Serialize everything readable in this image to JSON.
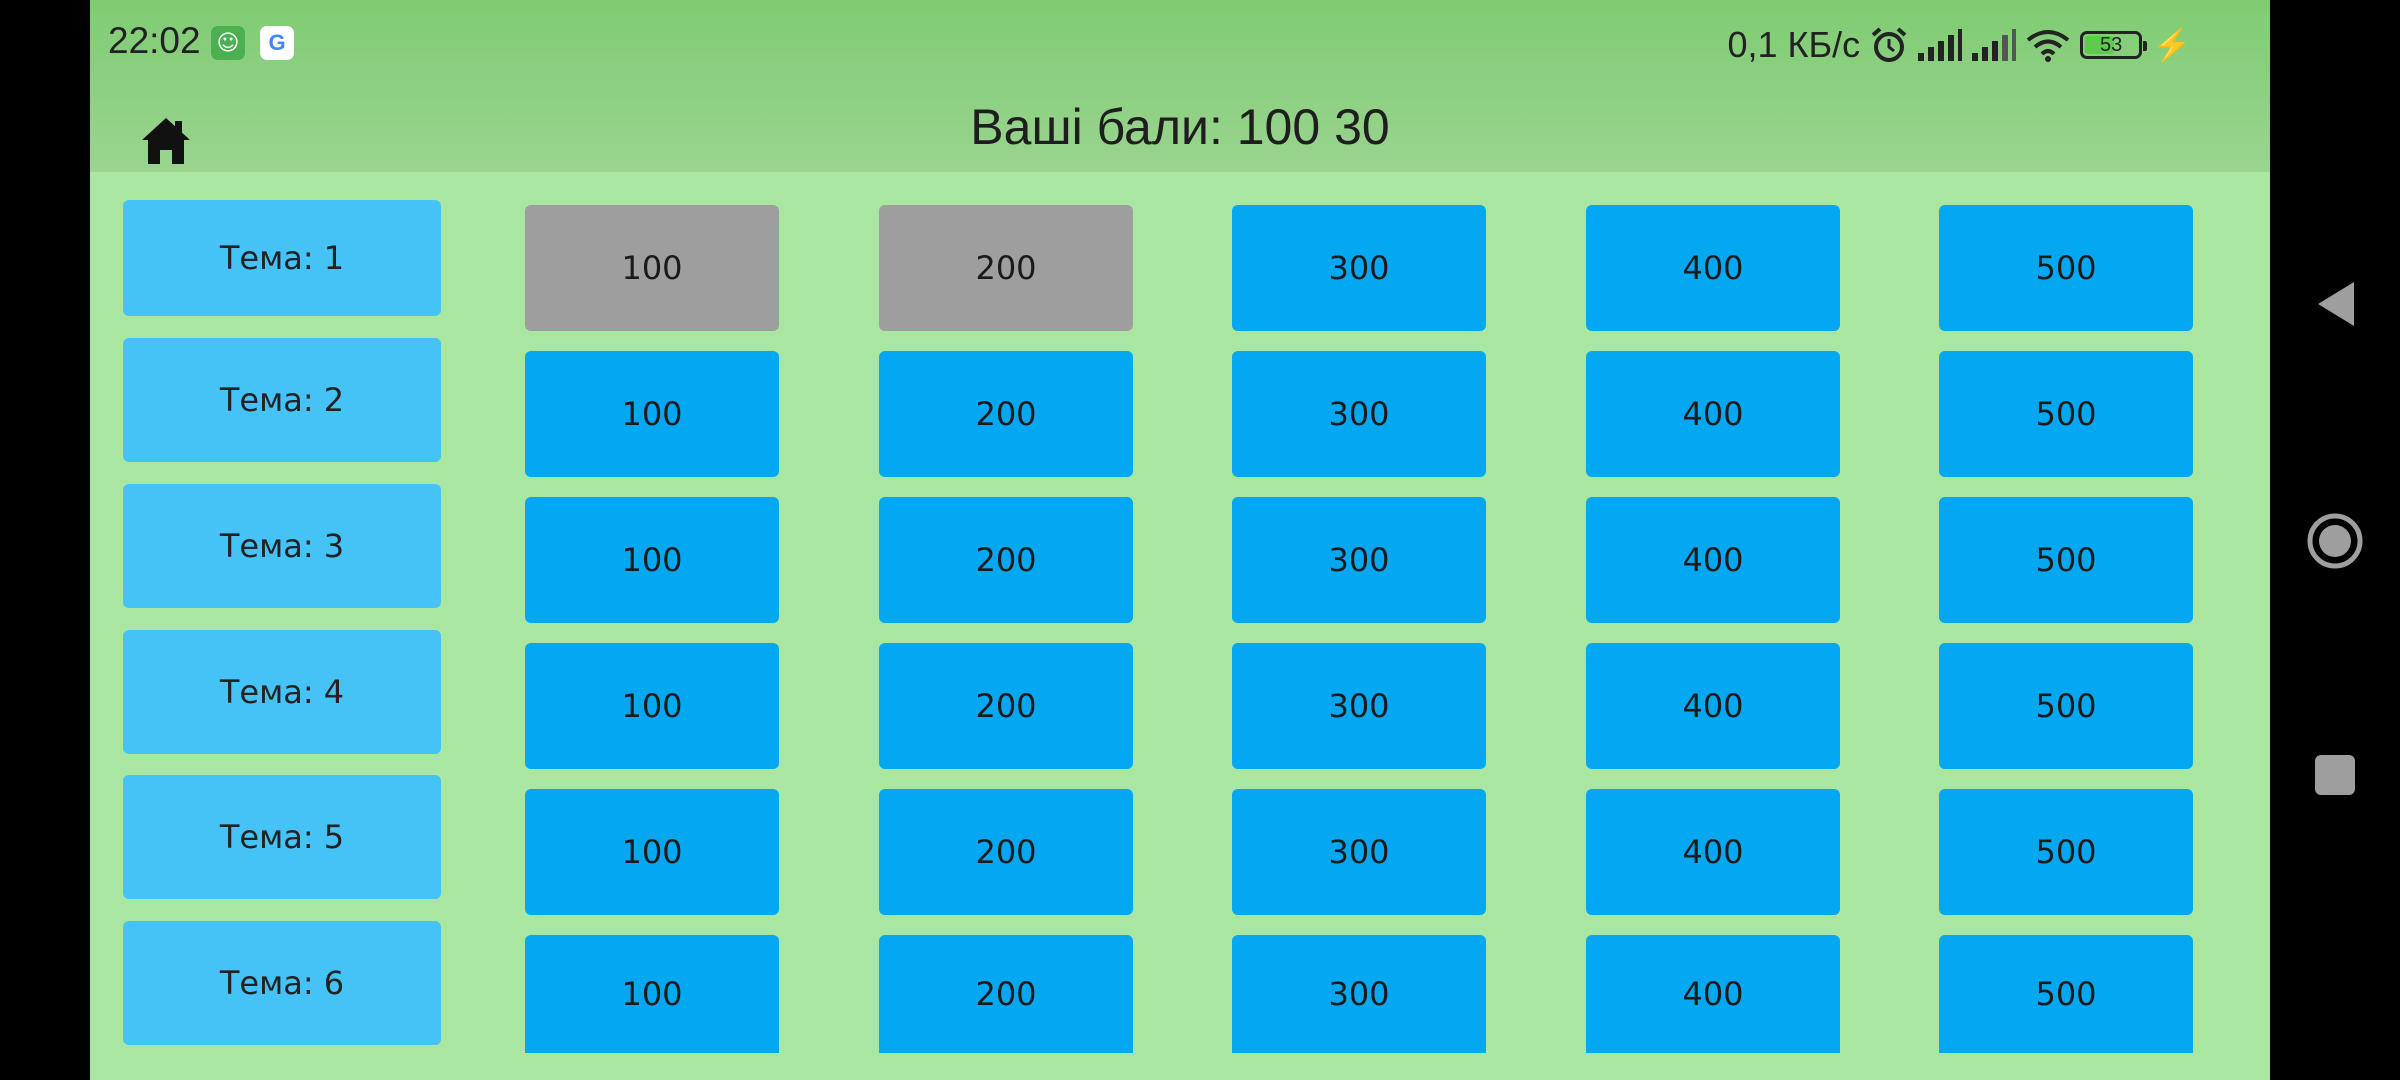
{
  "status_bar": {
    "time": "22:02",
    "speed": "0,1 КБ/с",
    "battery": "53",
    "battery_level": 0.53,
    "icons": [
      "app-notification-icon",
      "google-icon",
      "alarm-icon",
      "signal-icon",
      "signal-icon-2",
      "wifi-icon",
      "battery-icon",
      "charging-icon"
    ]
  },
  "header": {
    "score_text": "Ваші бали: 100 30",
    "home_icon": "home-icon"
  },
  "topics": [
    "Тема: 1",
    "Тема: 2",
    "Тема: 3",
    "Тема: 4",
    "Тема: 5",
    "Тема: 6"
  ],
  "board": {
    "values": [
      "100",
      "200",
      "300",
      "400",
      "500"
    ],
    "used": [
      [
        true,
        true,
        false,
        false,
        false
      ],
      [
        false,
        false,
        false,
        false,
        false
      ],
      [
        false,
        false,
        false,
        false,
        false
      ],
      [
        false,
        false,
        false,
        false,
        false
      ],
      [
        false,
        false,
        false,
        false,
        false
      ],
      [
        false,
        false,
        false,
        false,
        false
      ]
    ]
  },
  "colors": {
    "background": "#a8e6a1",
    "header": "#8fd283",
    "topic": "#45c3f7",
    "cell": "#04a7f1",
    "cell_used": "#9e9e9e"
  },
  "navigation": {
    "back_icon": "back-triangle-icon",
    "home_icon": "home-circle-icon",
    "recents_icon": "recents-square-icon"
  }
}
